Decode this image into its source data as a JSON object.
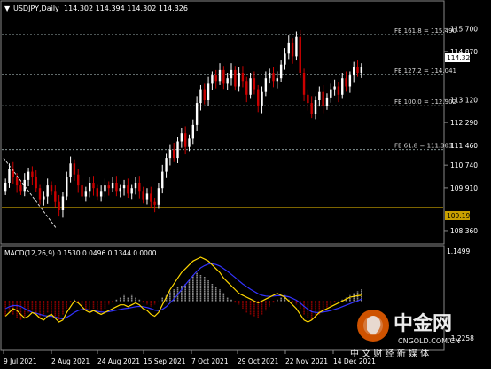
{
  "header": {
    "symbol": "USDJPY,Daily",
    "ohlc": "114.302 114.394 114.302 114.326"
  },
  "price_axis": {
    "ticks": [
      "115.700",
      "114.870",
      "113.120",
      "112.290",
      "111.460",
      "110.740",
      "109.910",
      "108.360"
    ],
    "current_price": "114.326",
    "support_level": "109.197"
  },
  "fib_levels": [
    {
      "label": "FE 161.8 = 115.490",
      "price": 115.49
    },
    {
      "label": "FE 127.2 = 114.041",
      "price": 114.041
    },
    {
      "label": "FE 100.0 = 112.902",
      "price": 112.902
    },
    {
      "label": "FE 61.8 = 111.303",
      "price": 111.303
    }
  ],
  "macd": {
    "label": "MACD(12,26,9) 0.1530 0.0496 0.1344 0.0000",
    "top_value": "1.1499",
    "bottom_value": "-1.2258"
  },
  "date_axis": [
    "9 Jul 2021",
    "2 Aug 2021",
    "24 Aug 2021",
    "15 Sep 2021",
    "7 Oct 2021",
    "29 Oct 2021",
    "22 Nov 2021",
    "14 Dec 2021"
  ],
  "watermark": {
    "brand": "中金网",
    "url": "CNGOLD.COM.CN",
    "slogan": "中 文 财 经 新 媒 体"
  },
  "colors": {
    "background": "#000000",
    "bull_candle": "#ffffff",
    "bear_candle": "#cc0000",
    "support_line": "#c8a000",
    "macd_line": "#ffd700",
    "signal_line": "#3333ff",
    "axis_text": "#ffffff"
  },
  "chart_data": {
    "type": "candlestick",
    "title": "USDJPY,Daily",
    "ylim": [
      108.1,
      116.1
    ],
    "closes": [
      110.1,
      110.6,
      110.3,
      110.0,
      109.8,
      110.2,
      110.5,
      110.3,
      109.9,
      109.5,
      109.6,
      110.0,
      109.8,
      109.4,
      109.1,
      109.6,
      110.3,
      110.8,
      110.4,
      110.0,
      109.6,
      109.8,
      110.1,
      109.9,
      109.6,
      109.8,
      110.0,
      109.9,
      110.1,
      109.8,
      109.9,
      110.0,
      109.7,
      109.9,
      110.1,
      109.8,
      109.5,
      109.7,
      109.4,
      109.3,
      109.9,
      110.5,
      111.0,
      111.3,
      111.0,
      111.6,
      111.9,
      111.4,
      111.7,
      112.2,
      113.0,
      113.5,
      113.1,
      113.7,
      114.0,
      113.8,
      114.2,
      113.7,
      113.9,
      114.2,
      113.6,
      114.1,
      113.8,
      113.3,
      113.9,
      113.5,
      112.9,
      113.4,
      113.9,
      114.1,
      113.8,
      113.9,
      114.4,
      114.8,
      115.2,
      114.7,
      115.4,
      114.1,
      113.3,
      113.0,
      112.6,
      113.1,
      113.4,
      112.9,
      113.2,
      113.5,
      113.6,
      113.3,
      113.9,
      113.6,
      114.0,
      114.3,
      114.1,
      114.3
    ],
    "macd_histogram": [
      -0.4,
      -0.3,
      -0.35,
      -0.45,
      -0.5,
      -0.4,
      -0.3,
      -0.25,
      -0.35,
      -0.45,
      -0.4,
      -0.3,
      -0.35,
      -0.4,
      -0.5,
      -0.35,
      -0.2,
      -0.05,
      0.05,
      -0.05,
      -0.15,
      -0.2,
      -0.25,
      -0.2,
      -0.25,
      -0.3,
      -0.2,
      -0.1,
      -0.05,
      0.05,
      0.1,
      0.15,
      0.1,
      0.15,
      0.1,
      0.05,
      -0.05,
      -0.1,
      -0.15,
      -0.1,
      0.0,
      0.1,
      0.15,
      0.25,
      0.3,
      0.35,
      0.4,
      0.45,
      0.55,
      0.7,
      0.75,
      0.7,
      0.65,
      0.55,
      0.45,
      0.35,
      0.3,
      0.2,
      0.1,
      0.05,
      -0.05,
      -0.1,
      -0.2,
      -0.3,
      -0.35,
      -0.4,
      -0.45,
      -0.35,
      -0.25,
      -0.15,
      -0.05,
      0.05,
      0.1,
      0.15,
      0.05,
      -0.05,
      -0.1,
      -0.2,
      -0.35,
      -0.45,
      -0.5,
      -0.45,
      -0.35,
      -0.3,
      -0.2,
      -0.15,
      -0.05,
      0.0,
      0.05,
      0.1,
      0.15,
      0.2,
      0.25,
      0.3
    ],
    "macd_line_values": [
      -0.4,
      -0.3,
      -0.2,
      -0.25,
      -0.35,
      -0.45,
      -0.4,
      -0.3,
      -0.35,
      -0.45,
      -0.5,
      -0.4,
      -0.35,
      -0.45,
      -0.55,
      -0.5,
      -0.3,
      -0.15,
      0.0,
      -0.05,
      -0.15,
      -0.25,
      -0.3,
      -0.25,
      -0.3,
      -0.35,
      -0.3,
      -0.25,
      -0.2,
      -0.15,
      -0.1,
      -0.1,
      -0.15,
      -0.1,
      -0.05,
      -0.1,
      -0.2,
      -0.25,
      -0.35,
      -0.4,
      -0.3,
      -0.1,
      0.1,
      0.3,
      0.45,
      0.6,
      0.75,
      0.85,
      0.95,
      1.05,
      1.1,
      1.15,
      1.1,
      1.05,
      0.95,
      0.85,
      0.75,
      0.6,
      0.5,
      0.4,
      0.3,
      0.2,
      0.15,
      0.1,
      0.05,
      0.0,
      -0.05,
      0.0,
      0.05,
      0.1,
      0.15,
      0.2,
      0.15,
      0.1,
      0.0,
      -0.1,
      -0.2,
      -0.35,
      -0.5,
      -0.55,
      -0.5,
      -0.4,
      -0.3,
      -0.25,
      -0.2,
      -0.15,
      -0.1,
      -0.05,
      0.0,
      0.05,
      0.1,
      0.12,
      0.14,
      0.15
    ],
    "signal_line_values": [
      -0.2,
      -0.15,
      -0.12,
      -0.12,
      -0.14,
      -0.2,
      -0.25,
      -0.3,
      -0.32,
      -0.35,
      -0.38,
      -0.4,
      -0.4,
      -0.42,
      -0.45,
      -0.47,
      -0.43,
      -0.37,
      -0.3,
      -0.25,
      -0.22,
      -0.22,
      -0.24,
      -0.25,
      -0.27,
      -0.29,
      -0.29,
      -0.28,
      -0.26,
      -0.24,
      -0.22,
      -0.2,
      -0.19,
      -0.17,
      -0.15,
      -0.14,
      -0.15,
      -0.17,
      -0.2,
      -0.24,
      -0.25,
      -0.22,
      -0.15,
      -0.05,
      0.05,
      0.17,
      0.3,
      0.43,
      0.55,
      0.67,
      0.78,
      0.87,
      0.93,
      0.97,
      0.98,
      0.96,
      0.92,
      0.85,
      0.78,
      0.7,
      0.62,
      0.53,
      0.45,
      0.38,
      0.31,
      0.25,
      0.19,
      0.15,
      0.13,
      0.12,
      0.13,
      0.14,
      0.14,
      0.13,
      0.11,
      0.07,
      0.02,
      -0.05,
      -0.14,
      -0.22,
      -0.28,
      -0.3,
      -0.3,
      -0.29,
      -0.27,
      -0.25,
      -0.22,
      -0.19,
      -0.15,
      -0.11,
      -0.07,
      -0.03,
      0.0,
      0.05
    ]
  }
}
